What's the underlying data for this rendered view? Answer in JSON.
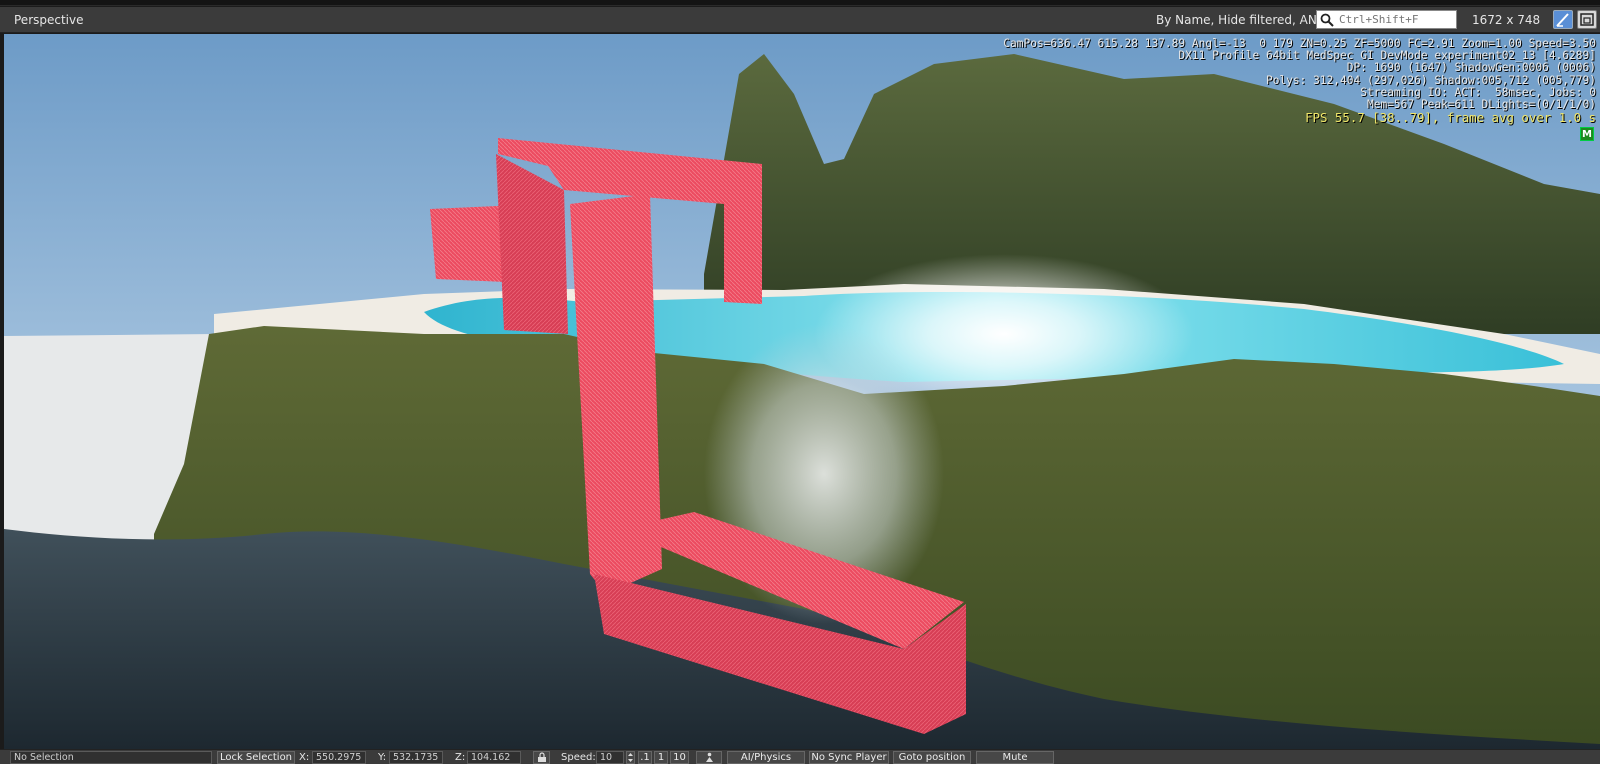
{
  "titlebar": {
    "title": "Perspective",
    "filter_label": "By Name, Hide filtered, AND",
    "search_placeholder": "Ctrl+Shift+F",
    "resolution": "1672 x 748"
  },
  "overlay": {
    "stats_lines": [
      "CamPos=636.47 615.28 137.89 Angl=-13  0 179 ZN=0.25 ZF=5000 FC=2.91 Zoom=1.00 Speed=3.50",
      "DX11 Profile 64bit MedSpec GI DevMode experiment02_13 [4.6289]",
      "DP: 1690 (1647) ShadowGen:0006 (0006)",
      "Polys: 312,404 (297,026) Shadow:005,712 (005,779)",
      "Streaming IO: ACT:  58msec, Jobs: 0",
      "Mem=567 Peak=611 DLights=(0/1/1/0)"
    ],
    "fps_line": "FPS 55.7 [38..79], frame avg over 1.0 s",
    "badge": "M"
  },
  "statusbar": {
    "selection": "No Selection",
    "lock_selection": "Lock Selection",
    "x_label": "X:",
    "x_value": "550.2975",
    "y_label": "Y:",
    "y_value": "532.1735",
    "z_label": "Z:",
    "z_value": "104.162",
    "speed_label": "Speed:",
    "speed_value": "10",
    "speed_presets": [
      ".1",
      "1",
      "10"
    ],
    "ai_physics": "AI/Physics",
    "sync_player": "No Sync Player",
    "goto_position": "Goto position",
    "mute": "Mute"
  },
  "colors": {
    "chrome": "#3b3b3b",
    "selection_red": "#ec4b60",
    "sky": "#a9c6e0",
    "water": "#41c1d8"
  }
}
